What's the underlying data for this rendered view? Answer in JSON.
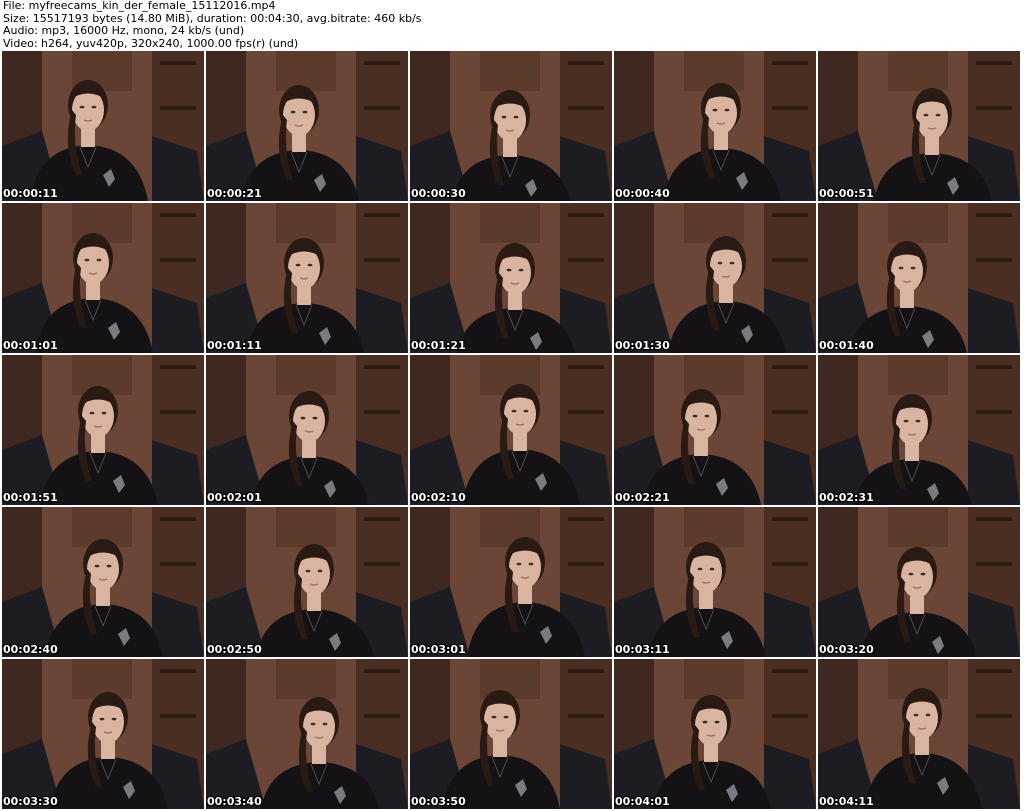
{
  "header": {
    "file": "File: myfreecams_kin_der_female_15112016.mp4",
    "size": "Size: 15517193 bytes (14.80 MiB), duration: 00:04:30, avg.bitrate: 460 kb/s",
    "audio": "Audio: mp3, 16000 Hz, mono, 24 kb/s (und)",
    "video": "Video: h264, yuv420p, 320x240, 1000.00 fps(r) (und)"
  },
  "thumbnails": [
    {
      "timestamp": "00:00:11"
    },
    {
      "timestamp": "00:00:21"
    },
    {
      "timestamp": "00:00:30"
    },
    {
      "timestamp": "00:00:40"
    },
    {
      "timestamp": "00:00:51"
    },
    {
      "timestamp": "00:01:01"
    },
    {
      "timestamp": "00:01:11"
    },
    {
      "timestamp": "00:01:21"
    },
    {
      "timestamp": "00:01:30"
    },
    {
      "timestamp": "00:01:40"
    },
    {
      "timestamp": "00:01:51"
    },
    {
      "timestamp": "00:02:01"
    },
    {
      "timestamp": "00:02:10"
    },
    {
      "timestamp": "00:02:21"
    },
    {
      "timestamp": "00:02:31"
    },
    {
      "timestamp": "00:02:40"
    },
    {
      "timestamp": "00:02:50"
    },
    {
      "timestamp": "00:03:01"
    },
    {
      "timestamp": "00:03:11"
    },
    {
      "timestamp": "00:03:20"
    },
    {
      "timestamp": "00:03:30"
    },
    {
      "timestamp": "00:03:40"
    },
    {
      "timestamp": "00:03:50"
    },
    {
      "timestamp": "00:04:01"
    },
    {
      "timestamp": "00:04:11"
    }
  ],
  "colors": {
    "wall": "#6b4535",
    "wall_dark": "#3e2820",
    "shelf": "#4a2e22",
    "skin": "#d9b4a0",
    "hair": "#2a1a14",
    "shirt": "#141214",
    "chair": "#1c1c22"
  }
}
